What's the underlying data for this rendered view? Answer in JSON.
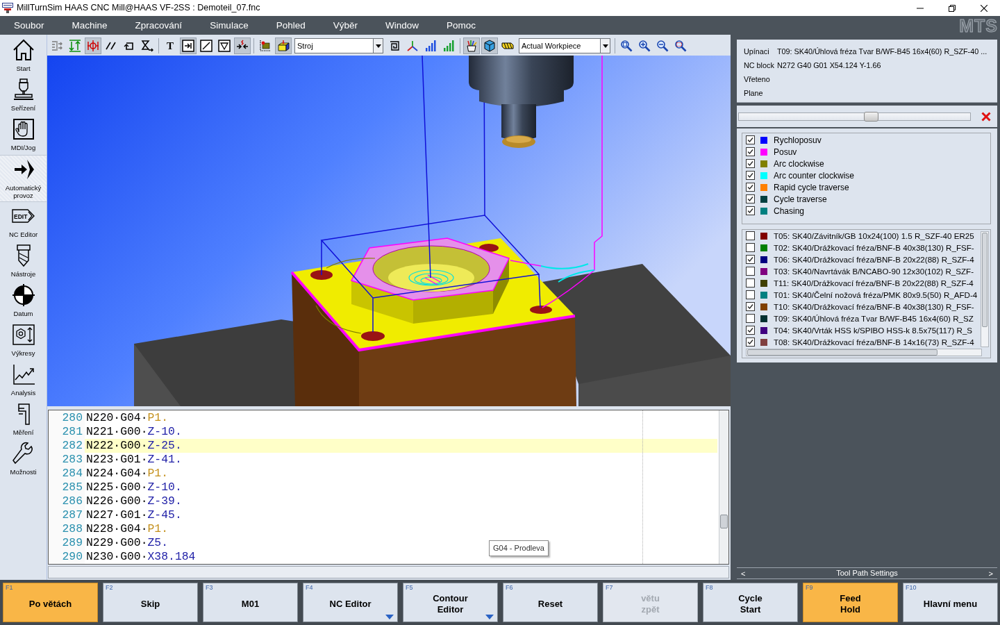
{
  "window": {
    "title": "MillTurnSim HAAS CNC Mill@HAAS VF-2SS : Demoteil_07.fnc"
  },
  "menu": [
    "Soubor",
    "Machine",
    "Zpracování",
    "Simulace",
    "Pohled",
    "Výběr",
    "Window",
    "Pomoc"
  ],
  "brand_logo": "MTS",
  "sidebar": {
    "items": [
      {
        "label": "Start",
        "selected": false
      },
      {
        "label": "Seřízení",
        "selected": false
      },
      {
        "label": "MDI/Jog",
        "selected": false
      },
      {
        "label": "Automatický provoz",
        "selected": true
      },
      {
        "label": "NC Editor",
        "selected": false,
        "icon_text": "EDIT"
      },
      {
        "label": "Nástroje",
        "selected": false
      },
      {
        "label": "Datum",
        "selected": false
      },
      {
        "label": "Výkresy",
        "selected": false
      },
      {
        "label": "Analysis",
        "selected": false
      },
      {
        "label": "Měření",
        "selected": false
      },
      {
        "label": "Možnosti",
        "selected": false
      }
    ]
  },
  "toolbar": {
    "groups": [
      [
        {
          "kind": "button",
          "pressed": false
        },
        {
          "kind": "button",
          "pressed": false
        },
        {
          "kind": "button",
          "pressed": true
        },
        {
          "kind": "button",
          "pressed": false
        },
        {
          "kind": "button",
          "pressed": false
        },
        {
          "kind": "button",
          "pressed": false
        }
      ],
      [
        {
          "kind": "text",
          "label": "T",
          "pressed": false
        },
        {
          "kind": "button",
          "pressed": true
        },
        {
          "kind": "button",
          "pressed": false
        },
        {
          "kind": "button",
          "pressed": false
        },
        {
          "kind": "button",
          "pressed": true
        }
      ],
      [
        {
          "kind": "button",
          "pressed": false
        },
        {
          "kind": "button",
          "pressed": true
        },
        {
          "kind": "dropdown",
          "value": "Stroj"
        },
        {
          "kind": "button",
          "pressed": false
        },
        {
          "kind": "button",
          "pressed": false
        },
        {
          "kind": "button",
          "pressed": false
        },
        {
          "kind": "button",
          "pressed": false
        }
      ],
      [
        {
          "kind": "button",
          "pressed": true
        },
        {
          "kind": "button",
          "pressed": true
        },
        {
          "kind": "button",
          "pressed": false
        },
        {
          "kind": "dropdown",
          "value": "Actual Workpiece"
        }
      ],
      [
        {
          "kind": "button",
          "pressed": false
        },
        {
          "kind": "button",
          "pressed": false
        },
        {
          "kind": "button",
          "pressed": false
        },
        {
          "kind": "button",
          "pressed": false
        }
      ]
    ]
  },
  "editor": {
    "lines": [
      {
        "number": "280",
        "block": "N220·G04·",
        "word": "P1.",
        "kind": "dwell",
        "selected": false
      },
      {
        "number": "281",
        "block": "N221·G00·",
        "word": "Z-10.",
        "kind": "axis",
        "selected": false
      },
      {
        "number": "282",
        "block": "N222·G00·",
        "word": "Z-25.",
        "kind": "axis",
        "selected": true
      },
      {
        "number": "283",
        "block": "N223·G01·",
        "word": "Z-41.",
        "kind": "axis",
        "selected": false
      },
      {
        "number": "284",
        "block": "N224·G04·",
        "word": "P1.",
        "kind": "dwell",
        "selected": false
      },
      {
        "number": "285",
        "block": "N225·G00·",
        "word": "Z-10.",
        "kind": "axis",
        "selected": false
      },
      {
        "number": "286",
        "block": "N226·G00·",
        "word": "Z-39.",
        "kind": "axis",
        "selected": false
      },
      {
        "number": "287",
        "block": "N227·G01·",
        "word": "Z-45.",
        "kind": "axis",
        "selected": false
      },
      {
        "number": "288",
        "block": "N228·G04·",
        "word": "P1.",
        "kind": "dwell",
        "selected": false
      },
      {
        "number": "289",
        "block": "N229·G00·",
        "word": "Z5.",
        "kind": "axis",
        "selected": false
      },
      {
        "number": "290",
        "block": "N230·G00·",
        "word": "X38.184",
        "kind": "axis",
        "selected": false
      }
    ],
    "tooltip": "G04 - Prodleva"
  },
  "info": [
    {
      "label": "Upínaci",
      "value": "T09: SK40/Úhlová fréza Tvar B/WF-B45 16x4(60) R_SZF-40 ..."
    },
    {
      "label": "NC block",
      "value": "N272 G40 G01 X54.124 Y-1.66"
    },
    {
      "label": "Vřeteno"
    },
    {
      "label": "Plane"
    }
  ],
  "playback_slider": {
    "level": 0.57
  },
  "path_legend": [
    {
      "label": "Rychloposuv",
      "checked": true,
      "color": "#0000ff"
    },
    {
      "label": "Posuv",
      "checked": true,
      "color": "#ff00ff"
    },
    {
      "label": "Arc clockwise",
      "checked": true,
      "color": "#808000"
    },
    {
      "label": "Arc counter clockwise",
      "checked": true,
      "color": "#00ffff"
    },
    {
      "label": "Rapid cycle traverse",
      "checked": true,
      "color": "#ff8000"
    },
    {
      "label": "Cycle traverse",
      "checked": true,
      "color": "#004040"
    },
    {
      "label": "Chasing",
      "checked": true,
      "color": "#008080"
    }
  ],
  "tools": [
    {
      "label": "T05: SK40/Závitník/GB 10x24(100) 1.5 R_SZF-40 ER25",
      "checked": false,
      "color": "#800000"
    },
    {
      "label": "T02: SK40/Drážkovací fréza/BNF-B 40x38(130) R_FSF-",
      "checked": false,
      "color": "#008000"
    },
    {
      "label": "T06: SK40/Drážkovací fréza/BNF-B 20x22(88) R_SZF-4",
      "checked": true,
      "color": "#000080"
    },
    {
      "label": "T03: SK40/Navrtávák B/NCABO-90 12x30(102) R_SZF-",
      "checked": false,
      "color": "#800080"
    },
    {
      "label": "T11: SK40/Drážkovací fréza/BNF-B 20x22(88) R_SZF-4",
      "checked": false,
      "color": "#404000"
    },
    {
      "label": "T01: SK40/Čelní nožová fréza/PMK 80x9.5(50) R_AFD-4",
      "checked": false,
      "color": "#008080"
    },
    {
      "label": "T10: SK40/Drážkovací fréza/BNF-B 40x38(130) R_FSF-",
      "checked": true,
      "color": "#804000"
    },
    {
      "label": "T09: SK40/Úhlová fréza Tvar B/WF-B45 16x4(60) R_SZ",
      "checked": false,
      "color": "#003030"
    },
    {
      "label": "T04: SK40/Vrták HSS k/SPIBO HSS-k 8.5x75(117) R_S",
      "checked": true,
      "color": "#400080"
    },
    {
      "label": "T08: SK40/Drážkovací fréza/BNF-B 14x16(73) R_SZF-4",
      "checked": true,
      "color": "#804040"
    }
  ],
  "panel_nav": {
    "previous": "<",
    "title": "Tool Path Settings",
    "next": ">"
  },
  "function_keys": [
    {
      "key": "F1",
      "label": "Po větách",
      "active": true,
      "disabled": false,
      "menu": false
    },
    {
      "key": "F2",
      "label": "Skip",
      "active": false,
      "disabled": false,
      "menu": false
    },
    {
      "key": "F3",
      "label": "M01",
      "active": false,
      "disabled": false,
      "menu": false
    },
    {
      "key": "F4",
      "label": "NC Editor",
      "active": false,
      "disabled": false,
      "menu": true
    },
    {
      "key": "F5",
      "label": "Contour\nEditor",
      "active": false,
      "disabled": false,
      "menu": true
    },
    {
      "key": "F6",
      "label": "Reset",
      "active": false,
      "disabled": false,
      "menu": false
    },
    {
      "key": "F7",
      "label": "větu\nzpět",
      "active": false,
      "disabled": true,
      "menu": false
    },
    {
      "key": "F8",
      "label": "Cycle\nStart",
      "active": false,
      "disabled": false,
      "menu": false
    },
    {
      "key": "F9",
      "label": "Feed\nHold",
      "active": true,
      "disabled": false,
      "menu": false
    },
    {
      "key": "F10",
      "label": "Hlavní menu",
      "active": false,
      "disabled": false,
      "menu": false
    }
  ]
}
